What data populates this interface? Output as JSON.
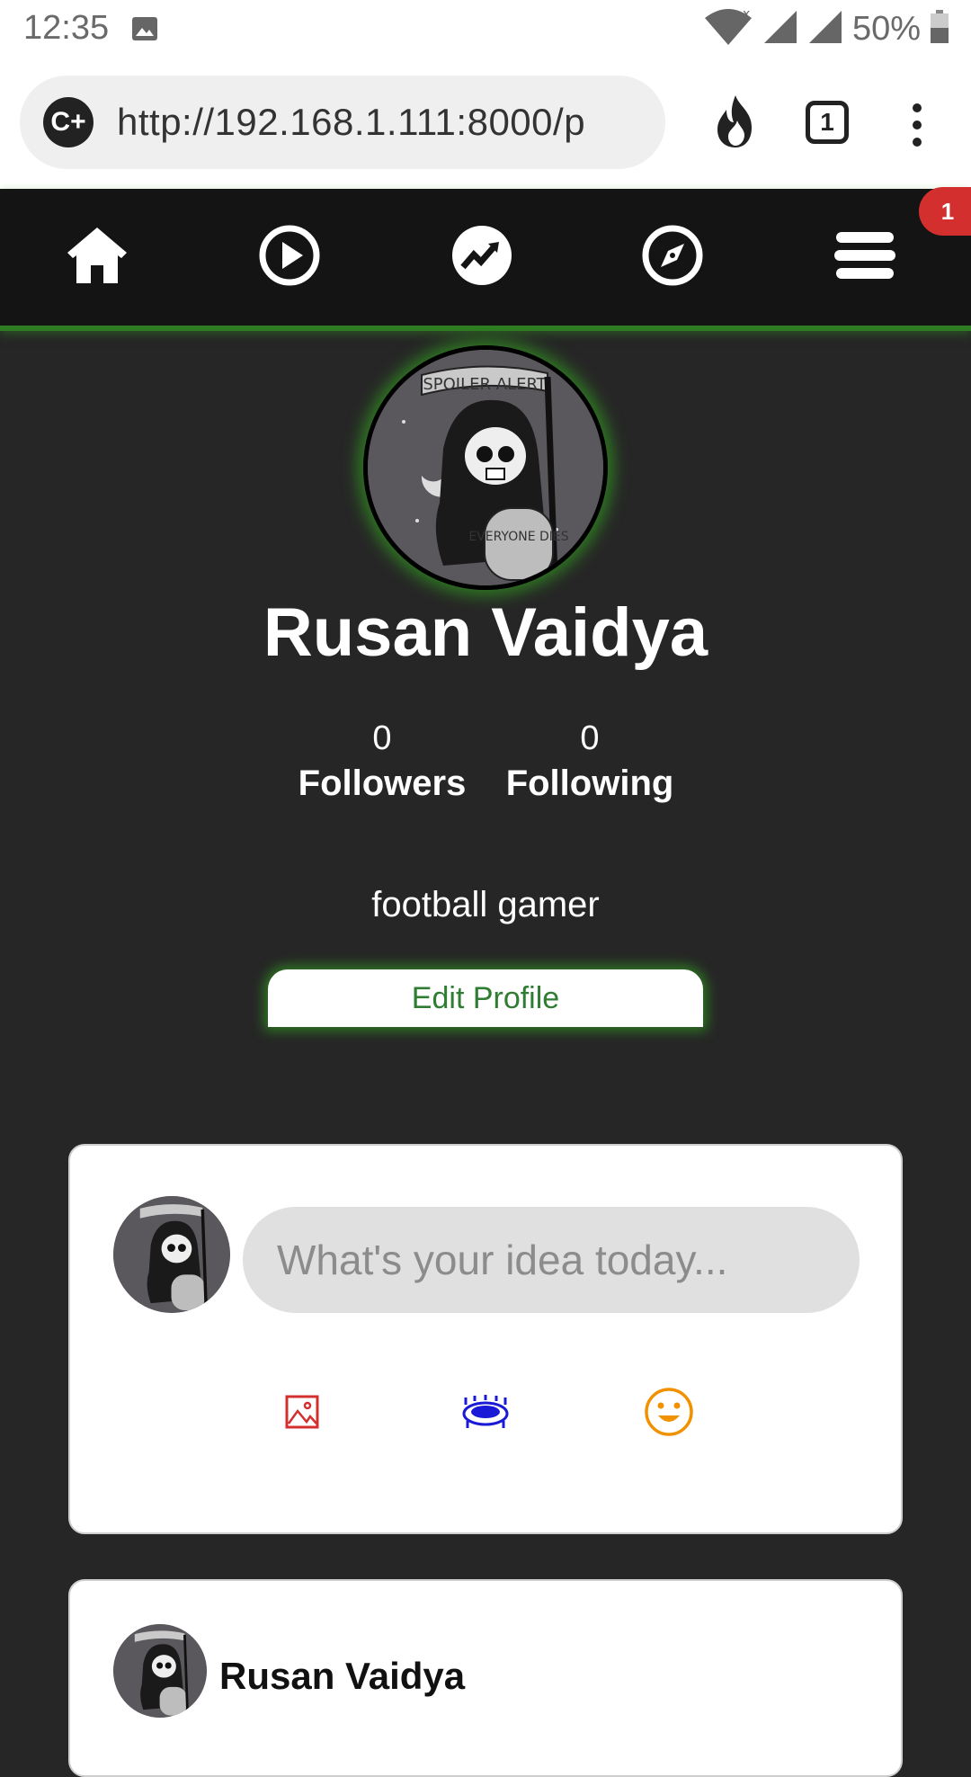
{
  "status_bar": {
    "time": "12:35",
    "battery": "50%",
    "icons": [
      "image-icon",
      "wifi-icon",
      "signal-icon",
      "battery-icon"
    ]
  },
  "browser": {
    "site_badge": "C+",
    "url": "http://192.168.1.111:8000/p",
    "tab_count": "1",
    "icons": [
      "fire-icon",
      "tabs-icon",
      "kebab-menu-icon"
    ]
  },
  "nav": {
    "items": [
      "home-icon",
      "play-icon",
      "trending-icon",
      "compass-icon",
      "menu-icon"
    ],
    "notification_count": "1",
    "accent": "#2f7d22",
    "badge_color": "#d32f2f"
  },
  "profile": {
    "name": "Rusan Vaidya",
    "avatar_text_top": "SPOILER ALERT",
    "avatar_text_bottom": "EVERYONE DIES",
    "followers": {
      "count": "0",
      "label": "Followers"
    },
    "following": {
      "count": "0",
      "label": "Following"
    },
    "bio": "football gamer",
    "edit_button": "Edit Profile"
  },
  "composer": {
    "placeholder": "What's your idea today...",
    "actions": [
      {
        "icon": "image-icon",
        "color": "#d32f2f"
      },
      {
        "icon": "stadium-icon",
        "color": "#1a1ad6"
      },
      {
        "icon": "emoji-icon",
        "color": "#f29100"
      }
    ]
  },
  "post": {
    "author": "Rusan Vaidya"
  }
}
